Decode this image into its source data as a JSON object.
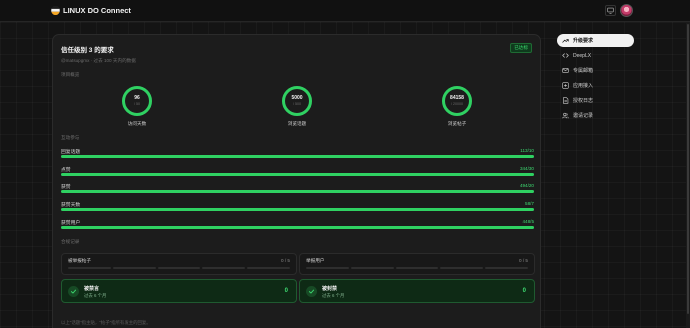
{
  "app": {
    "title": "LINUX DO Connect"
  },
  "card": {
    "title": "信任级别 3 的要求",
    "subtitle": "@matsupgmx · 过去 100 天内的数据",
    "status_badge": "已达标"
  },
  "sections": {
    "project_overview": "项目概览",
    "interaction": "互动参与",
    "violations": "合规记录"
  },
  "rings": [
    {
      "value": "96",
      "requirement": "/ 50",
      "label": "访问天数",
      "progress": 1.0
    },
    {
      "value": "5000",
      "requirement": "/ 500",
      "label": "浏览话题",
      "progress": 1.0
    },
    {
      "value": "84158",
      "requirement": "/ 20000",
      "label": "浏览帖子",
      "progress": 1.0
    }
  ],
  "bars": [
    {
      "name": "回复话题",
      "value": "113/10",
      "progress": 1.0
    },
    {
      "name": "点赞",
      "value": "344/30",
      "progress": 1.0
    },
    {
      "name": "获赞",
      "value": "494/20",
      "progress": 1.0
    },
    {
      "name": "获赞天数",
      "value": "58/7",
      "progress": 1.0
    },
    {
      "name": "获赞用户",
      "value": "448/5",
      "progress": 1.0
    }
  ],
  "flag_boxes": [
    {
      "name": "被举报帖子",
      "count": "0 / 5"
    },
    {
      "name": "举报用户",
      "count": "0 / 5"
    }
  ],
  "green_boxes": [
    {
      "title": "被禁言",
      "subtitle": "过去 6 个月",
      "count": "0"
    },
    {
      "title": "被封禁",
      "subtitle": "过去 6 个月",
      "count": "0"
    }
  ],
  "footnote": "以上\"话题\"指主贴，\"帖子\"指所有发主的回复。",
  "sidebar": {
    "items": [
      {
        "label": "升级要求",
        "icon": "trend-up-icon",
        "active": true
      },
      {
        "label": "DeepLX",
        "icon": "code-icon",
        "active": false
      },
      {
        "label": "专属邮箱",
        "icon": "mail-icon",
        "active": false
      },
      {
        "label": "应用接入",
        "icon": "app-icon",
        "active": false
      },
      {
        "label": "授权日志",
        "icon": "document-icon",
        "active": false
      },
      {
        "label": "邀请记录",
        "icon": "users-icon",
        "active": false
      }
    ]
  },
  "colors": {
    "accent_green": "#2fd162",
    "background": "#141414",
    "card": "#1c1c1c"
  }
}
